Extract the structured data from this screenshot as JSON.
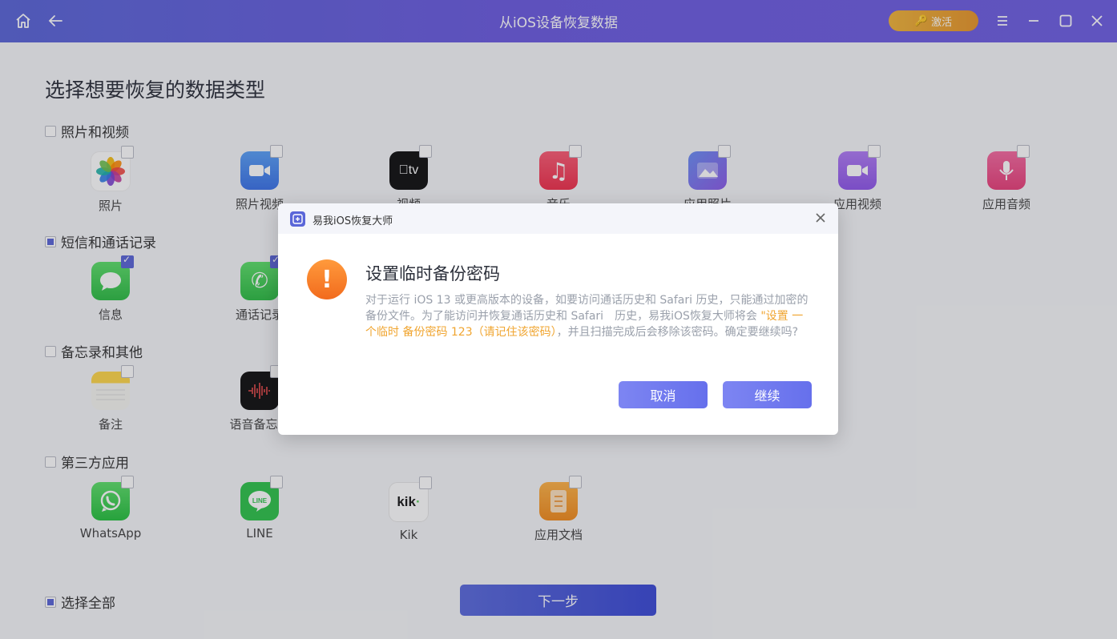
{
  "titlebar": {
    "title": "从iOS设备恢复数据",
    "activate_label": "激活"
  },
  "page": {
    "title": "选择想要恢复的数据类型"
  },
  "sections": {
    "media": {
      "label": "照片和视频",
      "items": [
        "照片",
        "照片视频",
        "视频",
        "音乐",
        "应用照片",
        "应用视频",
        "应用音频"
      ]
    },
    "messages": {
      "label": "短信和通话记录",
      "items": [
        "信息",
        "通话记录"
      ]
    },
    "notes": {
      "label": "备忘录和其他",
      "items": [
        "备注",
        "语音备忘录"
      ]
    },
    "thirdparty": {
      "label": "第三方应用",
      "items": [
        "WhatsApp",
        "LINE",
        "Kik",
        "应用文档"
      ]
    }
  },
  "footer": {
    "select_all": "选择全部",
    "next": "下一步"
  },
  "dialog": {
    "app_name": "易我iOS恢复大师",
    "title": "设置临时备份密码",
    "body_part1": "对于运行 iOS 13 或更高版本的设备，如要访问通话历史和 Safari 历史，只能通过加密的备份文件。为了能访问并恢复通话历史和 Safari　历史，易我iOS恢复大师将会 ",
    "body_highlight": "\"设置 一个临时 备份密码 123（请记住该密码）",
    "body_part2": "，并且扫描完成后会移除该密码。确定要继续吗?",
    "cancel": "取消",
    "continue": "继续"
  },
  "colors": {
    "accent": "#5a66d8",
    "warning": "#f26b1d",
    "highlight": "#f0a530"
  }
}
